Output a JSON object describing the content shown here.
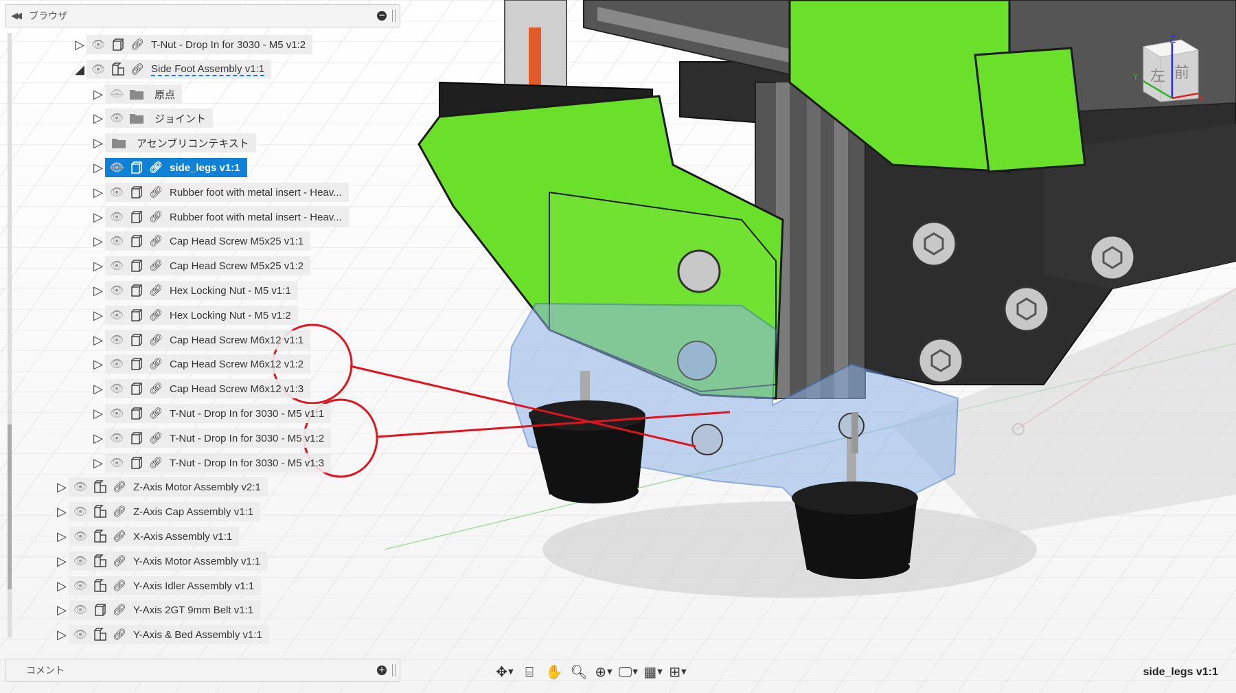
{
  "browser": {
    "title": "ブラウザ"
  },
  "tree": {
    "rows": [
      {
        "label": "T-Nut - Drop In for 3030 - M5 v1:2",
        "indent": 1,
        "icon": "body"
      },
      {
        "label": "Side Foot Assembly v1:1",
        "indent": 1,
        "icon": "assembly",
        "expanded": true
      },
      {
        "label": "原点",
        "indent": 2,
        "icon": "folder",
        "hidden": true
      },
      {
        "label": "ジョイント",
        "indent": 2,
        "icon": "folder"
      },
      {
        "label": "アセンブリコンテキスト",
        "indent": 2,
        "icon": "folder-noeye"
      },
      {
        "label": "side_legs v1:1",
        "indent": 2,
        "icon": "body",
        "selected": true,
        "hidden": true
      },
      {
        "label": "Rubber foot with metal insert - Heav...",
        "indent": 2,
        "icon": "body"
      },
      {
        "label": "Rubber foot with metal insert - Heav...",
        "indent": 2,
        "icon": "body"
      },
      {
        "label": "Cap Head Screw M5x25 v1:1",
        "indent": 2,
        "icon": "body"
      },
      {
        "label": "Cap Head Screw M5x25 v1:2",
        "indent": 2,
        "icon": "body"
      },
      {
        "label": "Hex Locking Nut - M5 v1:1",
        "indent": 2,
        "icon": "body"
      },
      {
        "label": "Hex Locking Nut - M5 v1:2",
        "indent": 2,
        "icon": "body"
      },
      {
        "label": "Cap Head Screw M6x12 v1:1",
        "indent": 2,
        "icon": "body"
      },
      {
        "label": "Cap Head Screw M6x12 v1:2",
        "indent": 2,
        "icon": "body"
      },
      {
        "label": "Cap Head Screw M6x12 v1:3",
        "indent": 2,
        "icon": "body"
      },
      {
        "label": "T-Nut - Drop In for 3030 - M5 v1:1",
        "indent": 2,
        "icon": "body"
      },
      {
        "label": "T-Nut - Drop In for 3030 - M5 v1:2",
        "indent": 2,
        "icon": "body"
      },
      {
        "label": "T-Nut - Drop In for 3030 - M5 v1:3",
        "indent": 2,
        "icon": "body"
      },
      {
        "label": "Z-Axis Motor Assembly v2:1",
        "indent": 0,
        "icon": "assembly"
      },
      {
        "label": "Z-Axis Cap Assembly v1:1",
        "indent": 0,
        "icon": "assembly"
      },
      {
        "label": "X-Axis Assembly v1:1",
        "indent": 0,
        "icon": "assembly"
      },
      {
        "label": "Y-Axis Motor Assembly v1:1",
        "indent": 0,
        "icon": "assembly"
      },
      {
        "label": "Y-Axis Idler Assembly v1:1",
        "indent": 0,
        "icon": "assembly"
      },
      {
        "label": "Y-Axis 2GT 9mm Belt v1:1",
        "indent": 0,
        "icon": "body"
      },
      {
        "label": "Y-Axis & Bed Assembly v1:1",
        "indent": 0,
        "icon": "assembly"
      }
    ]
  },
  "comments": {
    "title": "コメント"
  },
  "viewcube": {
    "left_label": "左",
    "front_label": "前",
    "z_label": "Z",
    "y_label": "Y",
    "x_label": "X"
  },
  "toolbar": {
    "tools": [
      "orbit-icon",
      "look-at-icon",
      "pan-icon",
      "zoom-icon",
      "fit-icon",
      "display-settings-icon",
      "grid-icon",
      "viewports-icon"
    ]
  },
  "document": {
    "name": "side_legs v1:1"
  },
  "colors": {
    "selection": "#0f81d6",
    "part_green": "#6be02b",
    "annotation_red": "#e0141e",
    "ghost_blue": "#8fb4e8"
  }
}
